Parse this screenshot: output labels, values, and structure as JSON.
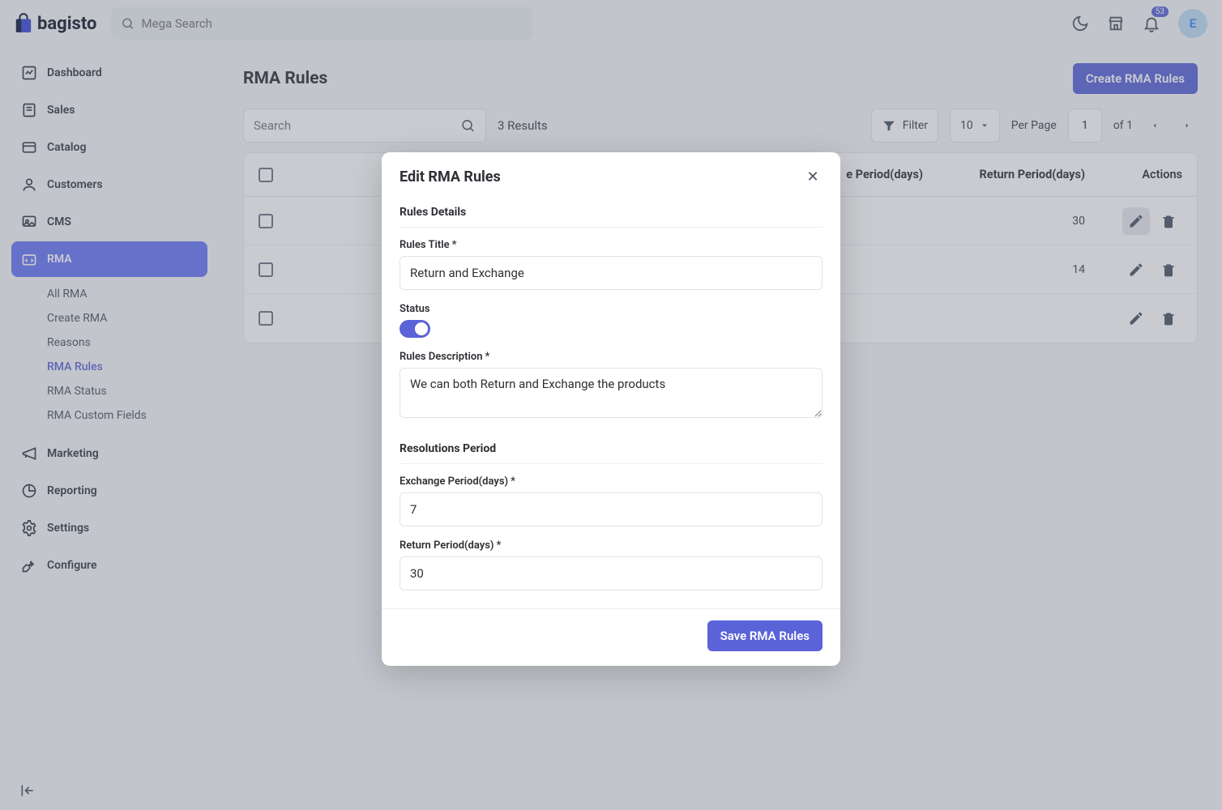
{
  "brand": "bagisto",
  "search": {
    "placeholder": "Mega Search"
  },
  "notifications": {
    "count": "53"
  },
  "avatar": "E",
  "sidebar": {
    "items": [
      {
        "label": "Dashboard"
      },
      {
        "label": "Sales"
      },
      {
        "label": "Catalog"
      },
      {
        "label": "Customers"
      },
      {
        "label": "CMS"
      },
      {
        "label": "RMA"
      },
      {
        "label": "Marketing"
      },
      {
        "label": "Reporting"
      },
      {
        "label": "Settings"
      },
      {
        "label": "Configure"
      }
    ],
    "rma_sub": [
      {
        "label": "All RMA"
      },
      {
        "label": "Create RMA"
      },
      {
        "label": "Reasons"
      },
      {
        "label": "RMA Rules"
      },
      {
        "label": "RMA Status"
      },
      {
        "label": "RMA Custom Fields"
      }
    ]
  },
  "page": {
    "title": "RMA Rules",
    "create_btn": "Create RMA Rules"
  },
  "toolbar": {
    "search_placeholder": "Search",
    "results": "3 Results",
    "filter": "Filter",
    "page_size": "10",
    "per_page": "Per Page",
    "current_page": "1",
    "of": "of 1"
  },
  "table": {
    "headers": {
      "exchange": "e Period(days)",
      "return": "Return Period(days)",
      "actions": "Actions"
    },
    "rows": [
      {
        "return": "30"
      },
      {
        "return": "14"
      },
      {
        "return": ""
      }
    ]
  },
  "modal": {
    "title": "Edit RMA Rules",
    "sections": {
      "details": "Rules Details",
      "resolutions": "Resolutions Period"
    },
    "labels": {
      "rules_title": "Rules Title",
      "status": "Status",
      "rules_desc": "Rules Description",
      "exchange": "Exchange Period(days)",
      "return": "Return Period(days)"
    },
    "values": {
      "rules_title": "Return and Exchange",
      "rules_desc": "We can both Return and Exchange the products",
      "exchange": "7",
      "return": "30"
    },
    "save_btn": "Save RMA Rules"
  }
}
